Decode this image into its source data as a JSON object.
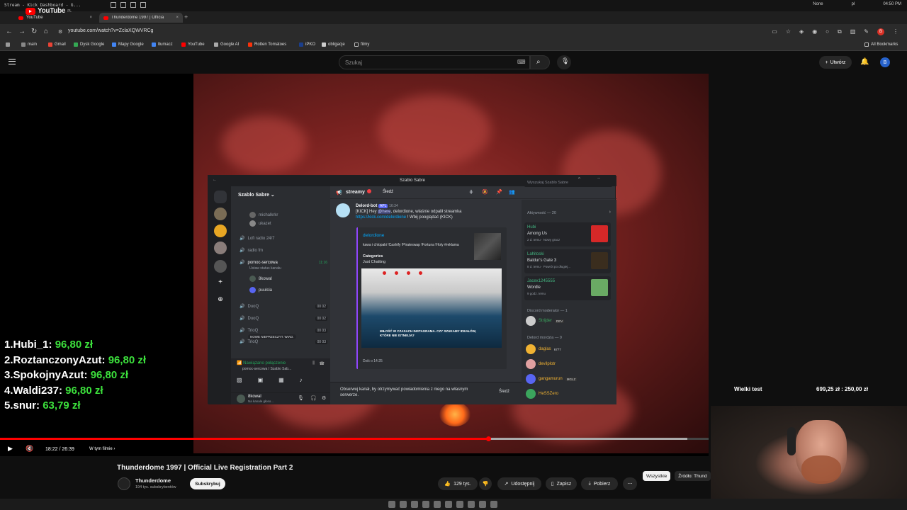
{
  "os": {
    "window_title": "Stream - Kick Dashboard - G...",
    "right_items": [
      "None",
      "pl",
      "04:50 PM"
    ]
  },
  "browser": {
    "tabs": [
      {
        "label": "YouTube",
        "active": false
      },
      {
        "label": "Thunderdome 1997 | Officia",
        "active": true
      }
    ],
    "url": "youtube.com/watch?v=ZclaXQWVRCg",
    "profile_initial": "B",
    "bookmarks": [
      "main",
      "Gmail",
      "Dysk Google",
      "Mapy Google",
      "tłumacz",
      "YouTube",
      "Google AI",
      "Rotten Tomatoes",
      "iPKO",
      "obligacje",
      "filmy"
    ],
    "all_bookmarks": "All Bookmarks"
  },
  "youtube": {
    "logo_text": "YouTube",
    "region": "PL",
    "search_placeholder": "Szukaj",
    "create_label": "Utwórz",
    "user_initial": "B"
  },
  "discord": {
    "window_title": "Szablo Sabre",
    "server_name": "Szablo Sabre",
    "channels": [
      {
        "name": "michalkrkr",
        "type": "user"
      },
      {
        "name": "ukazet",
        "type": "user"
      },
      {
        "name": "Lofi radio 24/7",
        "type": "voice"
      },
      {
        "name": "radio fm",
        "type": "voice"
      },
      {
        "name": "pomoc-sercowa",
        "type": "voice",
        "time": "11:16",
        "status": "Ustaw status kanału"
      },
      {
        "name": "DuoQ",
        "type": "voice",
        "count": "00 02"
      },
      {
        "name": "DuoQ",
        "type": "voice",
        "count": "00 02"
      },
      {
        "name": "TrioQ",
        "type": "voice",
        "count": "00 03"
      },
      {
        "name": "TrioQ",
        "type": "voice",
        "count": "00 03"
      }
    ],
    "voice_users": [
      "8kowal",
      "puulcia"
    ],
    "new_unread": "NOWE NIEPRZECZYT. WIAD.",
    "voice_connected": "Nawiązano połączenie",
    "voice_channel": "pomoc-sercowa / Szablo Sab...",
    "self_name": "8kowal",
    "self_status": "Na kanale głoso...",
    "channel_header": "streamy",
    "follow_label": "Śledź",
    "search_placeholder": "Wyszukaj Szablo Sabre",
    "message": {
      "author": "Delord-bot",
      "badge": "APL",
      "time": "16:34",
      "text1": "[KICK] Hey ",
      "mention": "@here",
      "text2": ", delordione, właśnie odpalił streamka",
      "link": "https://kick.com/delordione",
      "text3": " ! Wbij pooglądać (KICK)"
    },
    "embed": {
      "title": "delordione",
      "description": "kawa i chlopaki !Cashify !Pirateswap !Fortuna !Holy #reklama",
      "field_name": "Categories",
      "field_value": "Just Chatting",
      "thumb_caption": "MIŁOŚĆ W CZASACH INSTAGRAMA. CZY SZUKAMY IDEAŁÓW, KTÓRE NIE ISTNIEJĄ?",
      "footer": "Dziś o 14:25"
    },
    "follow_banner": "Obserwuj kanał, by otrzymywać powiadomienia z niego na własnym serwerze.",
    "follow_banner_btn": "Śledź",
    "activity_header": "Aktywność — 20",
    "activities": [
      {
        "user": "Hubi",
        "game": "Among Us",
        "meta": "2 d. temu · Nowy gracz",
        "color": "#d62828"
      },
      {
        "user": "Lahitoski",
        "game": "Baldur's Gate 3",
        "meta": "8 d. temu · Powrót po długiej...",
        "color": "#3a2d1e"
      },
      {
        "user": "Jacex1245555",
        "game": "Wordle",
        "meta": "9 godz. temu",
        "color": "#6aaa64"
      }
    ],
    "mod_header": "Discord moderator — 1",
    "mod_user": "Strijder",
    "mod_badge": "DEV",
    "group_header": "Delord mordzia — 9",
    "members": [
      {
        "name": "daglas",
        "badge": "6777",
        "color": "#f0b232"
      },
      {
        "name": "devilplotr",
        "badge": "",
        "color": "#e0a0a0"
      },
      {
        "name": "gangamurun",
        "badge": "MGLZ",
        "color": "#5865f2"
      },
      {
        "name": "HeSSZero",
        "badge": "",
        "color": "#3ba55d"
      }
    ]
  },
  "overlay": {
    "leaderboard": [
      {
        "rank": "1.",
        "name": "Hubi_1:",
        "amount": "96,80 zł"
      },
      {
        "rank": "2.",
        "name": "RoztanczonyAzut:",
        "amount": "96,80 zł"
      },
      {
        "rank": "3.",
        "name": "SpokojnyAzut:",
        "amount": "96,80 zł"
      },
      {
        "rank": "4.",
        "name": "Waldi237:",
        "amount": "96,80 zł"
      },
      {
        "rank": "5.",
        "name": "snur:",
        "amount": "63,79 zł"
      }
    ],
    "goal_label": "Wielki test",
    "goal_value": "699,25 zł : 250,00 zł"
  },
  "player": {
    "time": "18:22 / 26:39",
    "chapter": "W tym filmie",
    "progress_fraction": 0.689,
    "buffer_fraction": 0.97
  },
  "video": {
    "title": "Thunderdome 1997 | Official Live Registration Part 2",
    "channel": "Thunderdome",
    "subscribers": "194 tys. subskrybentów",
    "subscribe_label": "Subskrybuj",
    "likes": "129 tys.",
    "share": "Udostępnij",
    "save": "Zapisz",
    "download": "Pobierz",
    "more": "⋯"
  },
  "chips": [
    "Wszystkie",
    "Źródło: Thund"
  ]
}
